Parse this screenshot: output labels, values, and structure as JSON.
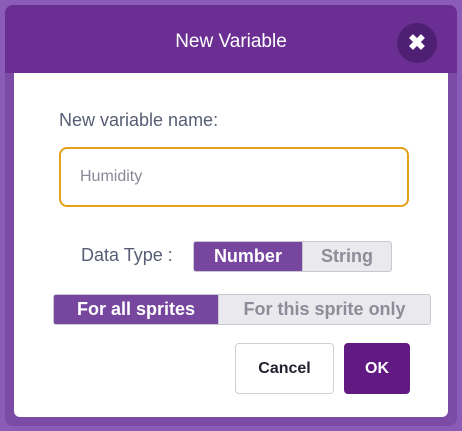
{
  "dialog": {
    "title": "New Variable",
    "close_icon": "close-icon",
    "close_glyph": "✖"
  },
  "form": {
    "name_label": "New variable name:",
    "name_value": "Humidity"
  },
  "data_type": {
    "label": "Data Type :",
    "options": [
      "Number",
      "String"
    ],
    "selected": "Number"
  },
  "scope": {
    "options": [
      "For all sprites",
      "For this sprite only"
    ],
    "selected": "For all sprites"
  },
  "actions": {
    "cancel_label": "Cancel",
    "ok_label": "OK"
  },
  "colors": {
    "header": "#6b2f93",
    "accent": "#77469f",
    "input_focus": "#e3a21a",
    "ok_button": "#621a83"
  }
}
